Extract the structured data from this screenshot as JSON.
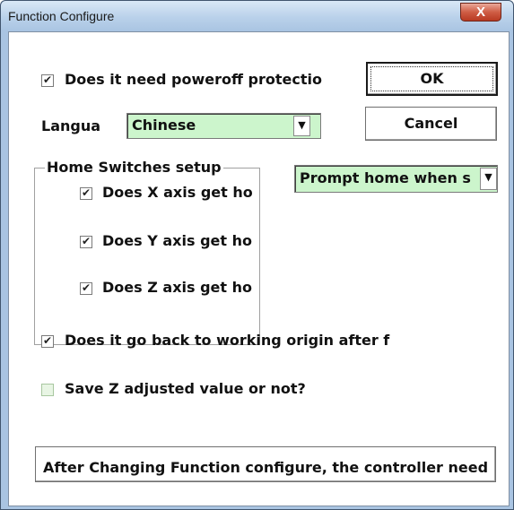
{
  "window": {
    "title": "Function Configure",
    "close_label": "X"
  },
  "options": {
    "poweroff": {
      "label": "Does it need poweroff protectio",
      "checked": true
    },
    "back_to_origin": {
      "label": "Does it go back to working origin after f",
      "checked": true
    },
    "save_z": {
      "label": "Save Z adjusted value or not?",
      "checked": false
    }
  },
  "language": {
    "label": "Langua",
    "selected": "Chinese"
  },
  "home_switches": {
    "title": "Home Switches setup",
    "x": {
      "label": "Does X axis get ho",
      "checked": true
    },
    "y": {
      "label": "Does Y axis get ho",
      "checked": true
    },
    "z": {
      "label": "Does Z axis get ho",
      "checked": true
    }
  },
  "prompt_home": {
    "selected": "Prompt home when s"
  },
  "buttons": {
    "ok": "OK",
    "cancel": "Cancel",
    "notice": "After Changing Function configure, the controller need to be restarted!"
  },
  "colors": {
    "field_bg": "#ccf5cc",
    "title_bar": "#b9d1ea",
    "close_button": "#cf5d45"
  },
  "icons": {
    "check": "check-mark-icon",
    "dropdown": "down-arrow-icon",
    "close": "close-icon"
  }
}
